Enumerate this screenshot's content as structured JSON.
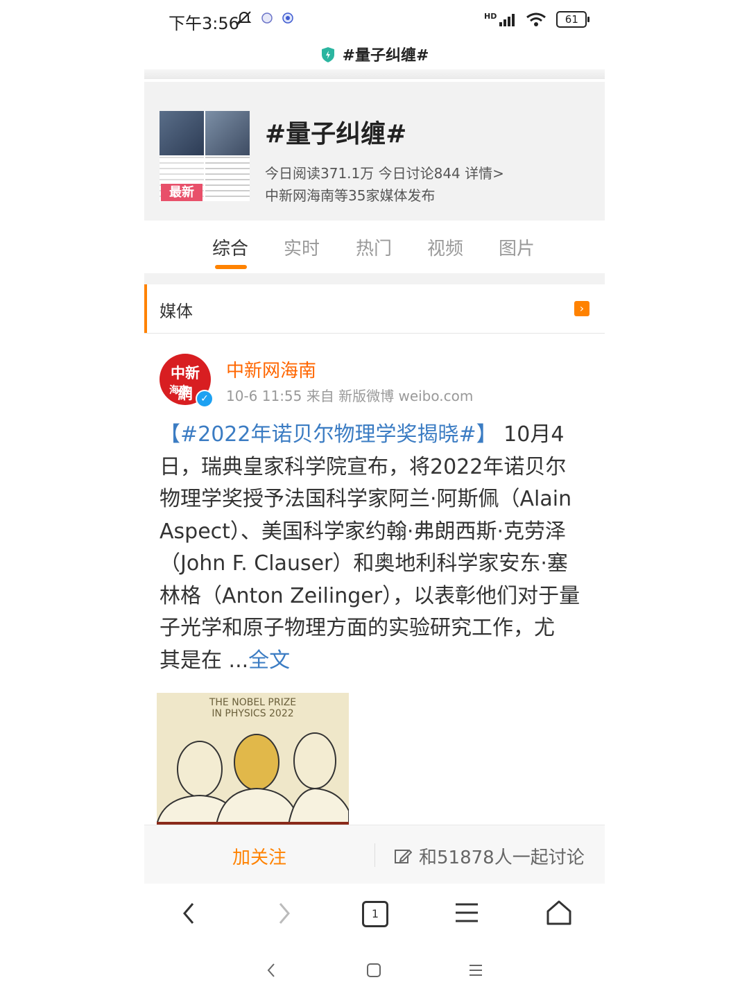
{
  "status": {
    "time": "下午3:56",
    "network": "HD",
    "battery": "61"
  },
  "page": {
    "title": "#量子纠缠#"
  },
  "topic": {
    "title": "#量子纠缠#",
    "thumb_badge": "最新",
    "stats": "今日阅读371.1万 今日讨论844 详情>",
    "media": "中新网海南等35家媒体发布"
  },
  "tabs": [
    {
      "label": "综合",
      "active": true
    },
    {
      "label": "实时"
    },
    {
      "label": "热门"
    },
    {
      "label": "视频"
    },
    {
      "label": "图片"
    }
  ],
  "section": {
    "label": "媒体"
  },
  "post": {
    "author": "中新网海南",
    "avatar_text_main": "中新網",
    "avatar_text_sub": "海南",
    "meta": "10-6 11:55 来自 新版微博 weibo.com",
    "hashtag": "【#2022年诺贝尔物理学奖揭晓#】",
    "body_lines": [
      " 10月4",
      "日，瑞典皇家科学院宣布，将2022年诺贝尔",
      "物理学奖授予法国科学家阿兰·阿斯佩（Alain",
      "Aspect）、美国科学家约翰·弗朗西斯·克劳泽",
      "（John F. Clauser）和奥地利科学家安东·塞",
      "林格（Anton Zeilinger），以表彰他们对于量",
      "子光学和原子物理方面的实验研究工作，尤",
      "其是在 ..."
    ],
    "more": "全文",
    "image_caption_1": "THE NOBEL PRIZE",
    "image_caption_2": "IN PHYSICS 2022"
  },
  "bottom_bar": {
    "follow": "加关注",
    "discuss": "和51878人一起讨论"
  },
  "browser": {
    "tab_count": "1"
  },
  "colors": {
    "accent": "#ff8200",
    "link": "#3b7cc3",
    "author": "#ff6600"
  }
}
